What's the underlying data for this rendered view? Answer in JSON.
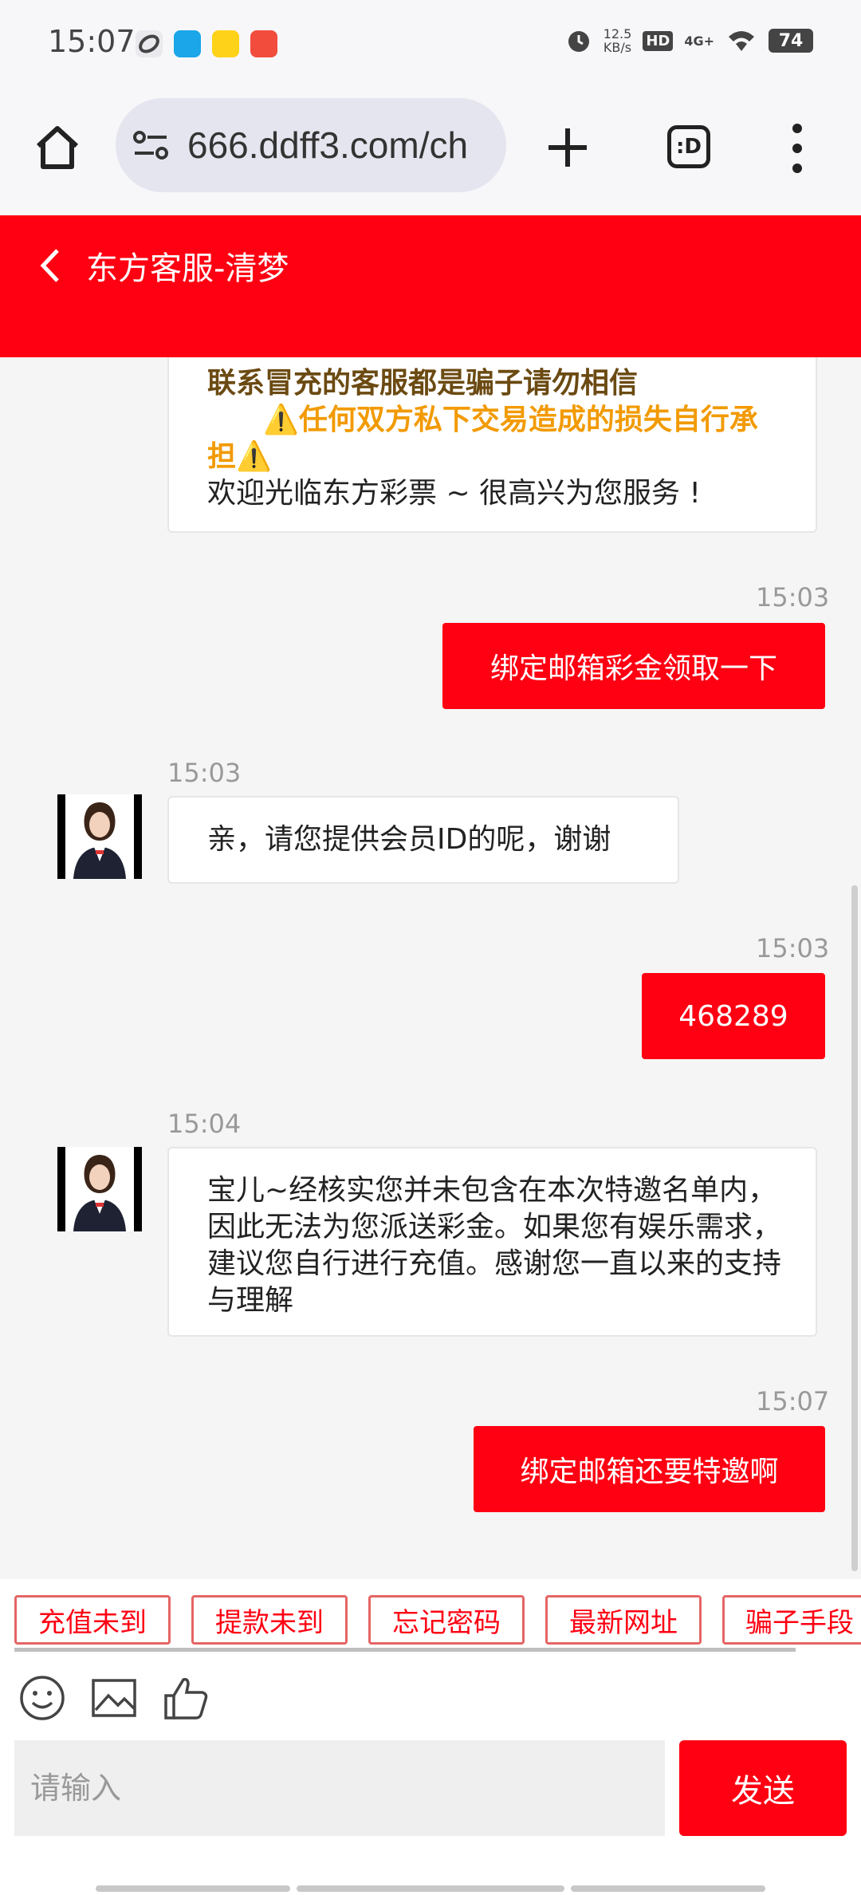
{
  "status_bar": {
    "time": "15:07",
    "net_speed_value": "12.5",
    "net_speed_unit": "KB/s",
    "hd": "HD",
    "network": "4G+",
    "battery": "74"
  },
  "browser": {
    "url": "666.ddff3.com/ch",
    "tabs_label": ":D"
  },
  "header": {
    "title": "东方客服-清梦"
  },
  "messages": {
    "notice_line1": "联系冒充的客服都是骗子请勿相信",
    "notice_line2": "⚠️任何双方私下交易造成的损失自行承",
    "notice_line3": "担⚠️",
    "welcome": "欢迎光临东方彩票 ~ 很高兴为您服务 !",
    "m1_time": "15:03",
    "m1_text": "绑定邮箱彩金领取一下",
    "m2_time": "15:03",
    "m2_text": "亲，请您提供会员ID的呢，谢谢",
    "m3_time": "15:03",
    "m3_text": "468289",
    "m4_time": "15:04",
    "m4_text": "宝儿~经核实您并未包含在本次特邀名单内，因此无法为您派送彩金。如果您有娱乐需求，建议您自行进行充值。感谢您一直以来的支持与理解",
    "m5_time": "15:07",
    "m5_text": "绑定邮箱还要特邀啊"
  },
  "quick_replies": [
    "充值未到",
    "提款未到",
    "忘记密码",
    "最新网址",
    "骗子手段"
  ],
  "input": {
    "placeholder": "请输入",
    "send_label": "发送"
  },
  "colors": {
    "accent": "#fe0012",
    "notice_dark": "#6b4a12",
    "notice_orange": "#f29a00"
  },
  "icons": [
    "home-icon",
    "site-settings-icon",
    "plus-icon",
    "tabs-icon",
    "more-icon",
    "back-icon",
    "emoji-icon",
    "image-icon",
    "like-icon"
  ]
}
